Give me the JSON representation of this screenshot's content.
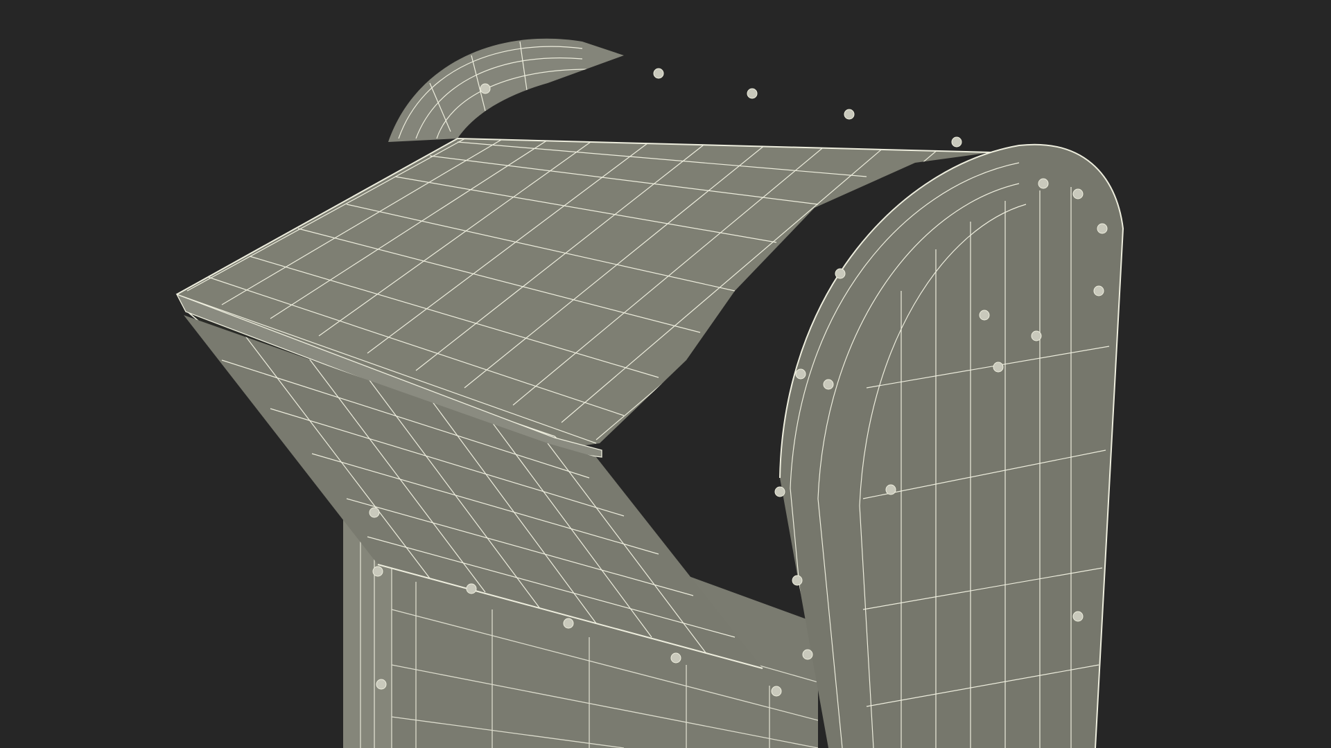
{
  "scene": {
    "subject": "mailbox-wireframe-render",
    "colors": {
      "background": "#262626",
      "surface": "#7c7d71",
      "surface_dark": "#5f6057",
      "surface_light": "#8a8b80",
      "slot_interior": "#2b2c28",
      "wire": "#eeeede",
      "rivet": "#c9c9bc"
    }
  }
}
